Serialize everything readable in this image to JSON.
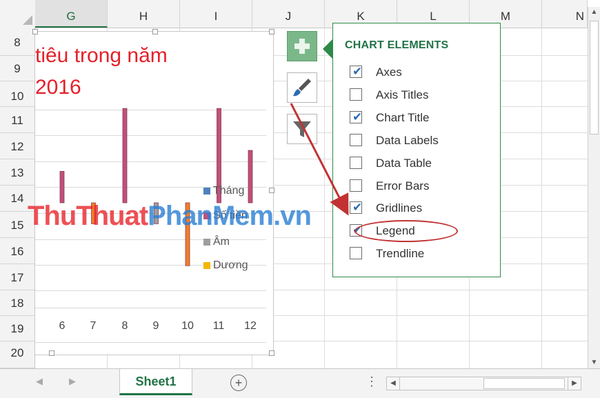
{
  "columns": [
    "G",
    "H",
    "I",
    "J",
    "K",
    "L",
    "M",
    "N"
  ],
  "rows": [
    "8",
    "9",
    "10",
    "11",
    "12",
    "13",
    "14",
    "15",
    "16",
    "17",
    "18",
    "19",
    "20"
  ],
  "chart": {
    "title_line1": "tiêu trong năm",
    "title_line2": "2016",
    "x_ticks": [
      "6",
      "7",
      "8",
      "9",
      "10",
      "11",
      "12"
    ],
    "legend": [
      {
        "label": "Tháng",
        "color": "#4f81bd"
      },
      {
        "label": "Số tiền",
        "color": "#c0507a"
      },
      {
        "label": "Âm",
        "color": "#9e9e9e"
      },
      {
        "label": "Dương",
        "color": "#f2b705"
      }
    ]
  },
  "chart_data": {
    "type": "bar",
    "categories": [
      "6",
      "7",
      "8",
      "9",
      "10",
      "11",
      "12"
    ],
    "series": [
      {
        "name": "Số tiền",
        "values": [
          1.2,
          0,
          3.6,
          0,
          0,
          3.6,
          2.0
        ]
      },
      {
        "name": "Dương",
        "values": [
          0,
          -0.8,
          0,
          0,
          -2.4,
          0,
          0
        ]
      },
      {
        "name": "Âm",
        "values": [
          0,
          0,
          0,
          -0.8,
          0,
          0,
          0
        ]
      }
    ],
    "series_colors": [
      "#c0507a",
      "#f07f26",
      "#9e9e9e"
    ],
    "ylim": [
      -3,
      4
    ],
    "grid": true,
    "legend_position": "right"
  },
  "watermark": {
    "part1": "ThuThuat",
    "part2": "PhanMem.vn"
  },
  "side_buttons": {
    "plus_icon": "plus-icon",
    "brush_icon": "paintbrush-icon",
    "filter_icon": "filter-icon"
  },
  "flyout": {
    "title": "CHART ELEMENTS",
    "items": [
      {
        "label": "Axes",
        "checked": true
      },
      {
        "label": "Axis Titles",
        "checked": false
      },
      {
        "label": "Chart Title",
        "checked": true
      },
      {
        "label": "Data Labels",
        "checked": false
      },
      {
        "label": "Data Table",
        "checked": false
      },
      {
        "label": "Error Bars",
        "checked": false
      },
      {
        "label": "Gridlines",
        "checked": true
      },
      {
        "label": "Legend",
        "checked": true
      },
      {
        "label": "Trendline",
        "checked": false
      }
    ]
  },
  "sheet": {
    "tab_label": "Sheet1",
    "add_icon": "⊕",
    "dots": "⋮"
  },
  "colors": {
    "excel_green": "#217346",
    "annotation_red": "#c23232"
  }
}
